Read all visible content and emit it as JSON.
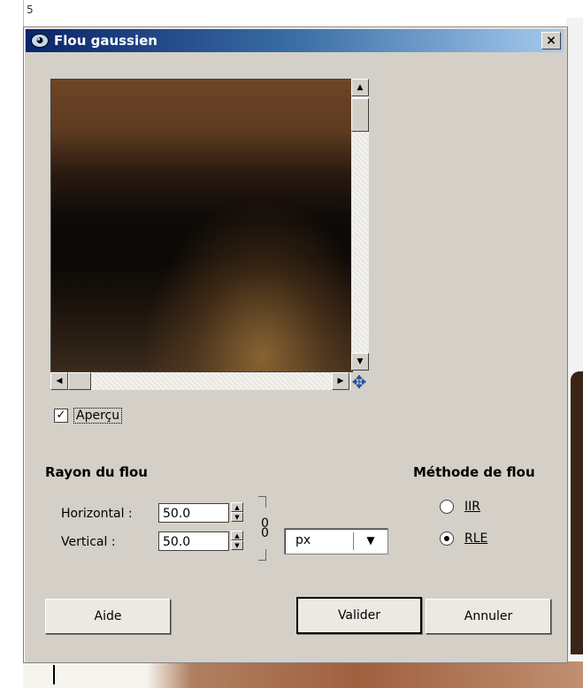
{
  "dialog": {
    "title": "Flou gaussien",
    "close_label": "×",
    "background_mark": "5"
  },
  "preview": {
    "show_preview": true,
    "preview_label": "Aperçu",
    "preview_check": "✓"
  },
  "blur_radius": {
    "section_title": "Rayon du flou",
    "horizontal_label": "Horizontal :",
    "horizontal_value": "50.0",
    "vertical_label": "Vertical :",
    "vertical_value": "50.0",
    "unit": "px"
  },
  "blur_method": {
    "section_title": "Méthode de flou",
    "options": [
      {
        "label": "IIR",
        "selected": false
      },
      {
        "label": "RLE",
        "selected": true
      }
    ]
  },
  "buttons": {
    "help": "Aide",
    "ok": "Valider",
    "cancel": "Annuler"
  },
  "icons": {
    "title": "gimp-icon",
    "close": "close-icon",
    "navigate": "navigate-icon",
    "chain": "chain-link-icon",
    "dropdown": "chevron-down-icon"
  }
}
